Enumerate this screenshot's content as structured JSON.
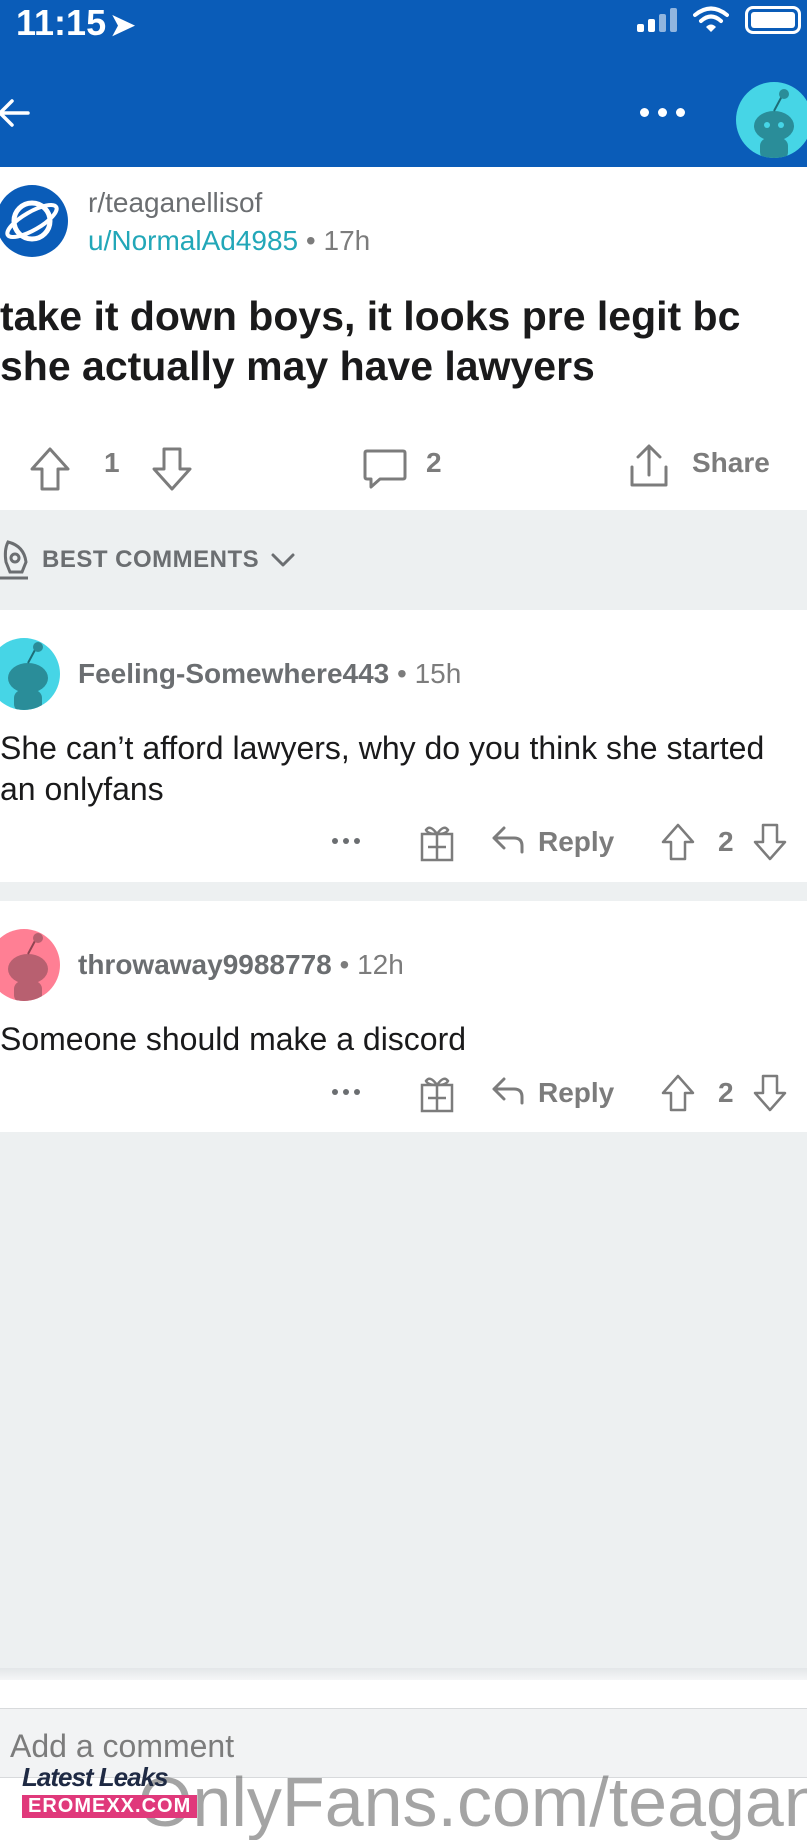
{
  "status_bar": {
    "time": "11:15"
  },
  "post": {
    "subreddit": "r/teaganellisof",
    "author": "u/NormalAd4985",
    "age": "17h",
    "title": "take it down boys, it looks pre legit bc she actually may have lawyers",
    "score": "1",
    "comment_count": "2",
    "share_label": "Share"
  },
  "sort": {
    "label": "BEST COMMENTS"
  },
  "comments": [
    {
      "username": "Feeling-Somewhere443",
      "age": "15h",
      "body": "She can’t afford lawyers, why do you think she started an onlyfans",
      "reply_label": "Reply",
      "score": "2",
      "avatar_color": "#46d5e6"
    },
    {
      "username": "throwaway9988778",
      "age": "12h",
      "body": "Someone should make a discord",
      "reply_label": "Reply",
      "score": "2",
      "avatar_color": "#ff7f94"
    }
  ],
  "compose": {
    "placeholder": "Add a comment"
  },
  "watermark": {
    "text": "OnlyFans.com/teagan",
    "badge_top": "Latest Leaks",
    "badge_bottom": "EROMEXX.COM"
  },
  "colors": {
    "header": "#0a5cb8",
    "accent_teal": "#22a7b8",
    "muted": "#7c7c7c"
  }
}
